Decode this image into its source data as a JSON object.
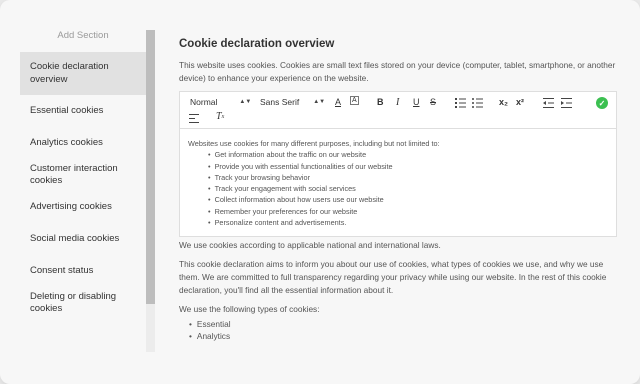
{
  "sidebar": {
    "add_section": "Add Section",
    "items": [
      {
        "label": "Cookie declaration overview"
      },
      {
        "label": "Essential cookies"
      },
      {
        "label": "Analytics cookies"
      },
      {
        "label": "Customer interaction cookies"
      },
      {
        "label": "Advertising cookies"
      },
      {
        "label": "Social media cookies"
      },
      {
        "label": "Consent status"
      },
      {
        "label": "Deleting or disabling cookies"
      }
    ]
  },
  "main": {
    "title": "Cookie declaration overview",
    "intro": "This website uses cookies. Cookies are small text files stored on your device (computer, tablet, smartphone, or another device) to enhance your experience on the website.",
    "editor": {
      "toolbar": {
        "heading_select": "Normal",
        "font_select": "Sans Serif",
        "bold": "B",
        "italic": "I",
        "underline": "U",
        "strike": "S",
        "subscript": "x₂",
        "superscript": "x²"
      },
      "lead": "Websites use cookies for many different purposes, including but not limited to:",
      "bullets": [
        "Get information about the traffic on our website",
        "Provide you with essential functionalities of our website",
        "Track your browsing behavior",
        "Track your engagement with social services",
        "Collect information about how users use our website",
        "Remember your preferences for our website",
        "Personalize content and advertisements."
      ]
    },
    "p1": "We use cookies according to applicable national and international laws.",
    "p2": "This cookie declaration aims to inform you about our use of cookies, what types of cookies we use, and why we use them. We are committed to full transparency regarding your privacy while using our website. In the rest of this cookie declaration, you'll find all the essential information about it.",
    "p3": "We use the following types of cookies:",
    "types": [
      "Essential",
      "Analytics"
    ]
  },
  "colors": {
    "accent_check": "#3cc051",
    "active_item": "#e1e1e1"
  }
}
